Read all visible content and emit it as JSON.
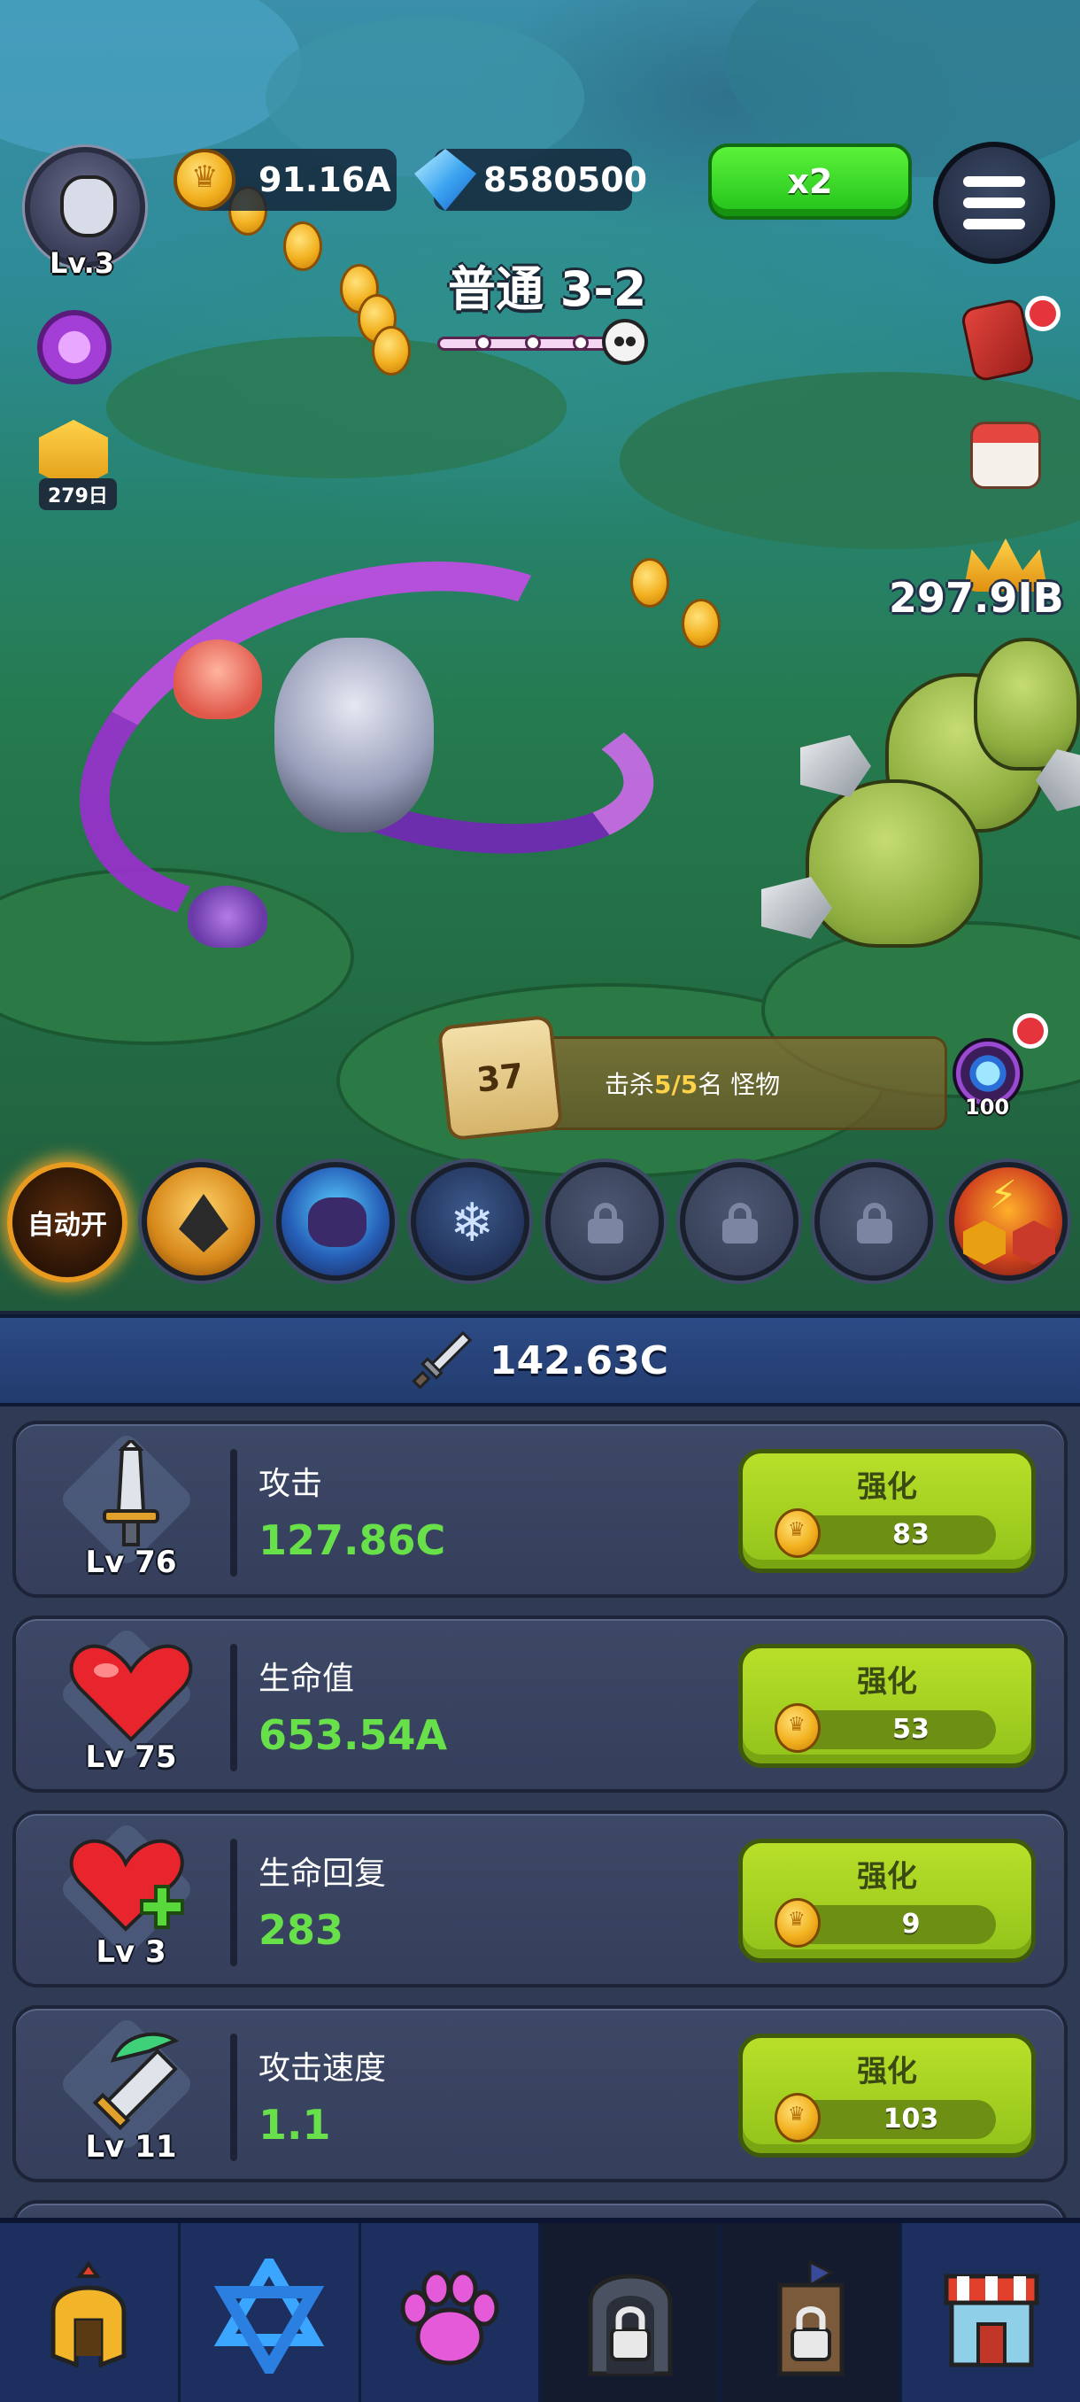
{
  "player": {
    "level": "Lv.3"
  },
  "resources": {
    "gold": "91.16A",
    "gems": "8580500"
  },
  "speed_button": "x2",
  "stage": {
    "title": "普通 3-2"
  },
  "left_badge": {
    "days": "279日"
  },
  "damage_popup": "297.9IB",
  "quest": {
    "number": "37",
    "text_prefix": "击杀",
    "progress": "5/5",
    "text_suffix": "名 怪物"
  },
  "gem_reward": "100",
  "auto_button": "自动开",
  "total_power": "142.63C",
  "stats": [
    {
      "level": "Lv 76",
      "name": "攻击",
      "value": "127.86C",
      "button": "强化",
      "cost": "83",
      "icon": "sword-icon"
    },
    {
      "level": "Lv 75",
      "name": "生命值",
      "value": "653.54A",
      "button": "强化",
      "cost": "53",
      "icon": "heart-icon"
    },
    {
      "level": "Lv 3",
      "name": "生命回复",
      "value": "283",
      "button": "强化",
      "cost": "9",
      "icon": "heart-plus-icon"
    },
    {
      "level": "Lv 11",
      "name": "攻击速度",
      "value": "1.1",
      "button": "强化",
      "cost": "103",
      "icon": "speed-sword-icon"
    }
  ],
  "nav_items": [
    "helmet-icon",
    "star-icon",
    "paw-icon",
    "locked-gate-icon",
    "locked-tower-icon",
    "shop-icon"
  ],
  "colors": {
    "accent_green": "#67e04a",
    "button_lime": "#a6d221",
    "panel": "#2f3a55",
    "power_bar": "#2c4a85"
  }
}
